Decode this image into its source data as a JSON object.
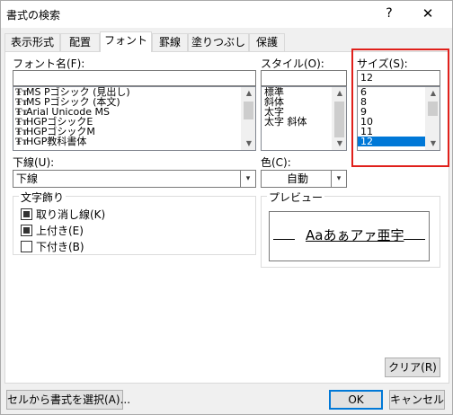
{
  "dialog": {
    "title": "書式の検索",
    "help_label": "?",
    "close_label": "✕"
  },
  "tabs": [
    {
      "label": "表示形式",
      "active": false
    },
    {
      "label": "配置",
      "active": false
    },
    {
      "label": "フォント",
      "active": true
    },
    {
      "label": "罫線",
      "active": false
    },
    {
      "label": "塗りつぶし",
      "active": false
    },
    {
      "label": "保護",
      "active": false
    }
  ],
  "font": {
    "label": "フォント名(F):",
    "value": "",
    "items": [
      "MS Pゴシック (見出し)",
      "MS Pゴシック (本文)",
      "Arial Unicode MS",
      "HGPゴシックE",
      "HGPゴシックM",
      "HGP教科書体"
    ],
    "icon_glyph": "Ŧт"
  },
  "style": {
    "label": "スタイル(O):",
    "value": "",
    "items": [
      "標準",
      "斜体",
      "太字",
      "太字 斜体"
    ]
  },
  "size": {
    "label": "サイズ(S):",
    "value": "12",
    "items": [
      "6",
      "8",
      "9",
      "10",
      "11",
      "12"
    ],
    "selected": "12"
  },
  "underline": {
    "label": "下線(U):",
    "value": "下線"
  },
  "color": {
    "label": "色(C):",
    "value": "自動"
  },
  "effects": {
    "title": "文字飾り",
    "items": [
      {
        "label": "取り消し線(K)",
        "state": "indeterminate"
      },
      {
        "label": "上付き(E)",
        "state": "indeterminate"
      },
      {
        "label": "下付き(B)",
        "state": "unchecked"
      }
    ]
  },
  "preview": {
    "title": "プレビュー",
    "sample": "Aaあぁアァ亜宇"
  },
  "buttons": {
    "clear": "クリア(R)",
    "choose_from_cell": "セルから書式を選択(A)...",
    "ok": "OK",
    "cancel": "キャンセル"
  },
  "scroll_arrows": {
    "up": "▲",
    "down": "▼",
    "combo": "▾"
  },
  "colors": {
    "highlight": "#e0201b",
    "selection": "#0078d7"
  }
}
